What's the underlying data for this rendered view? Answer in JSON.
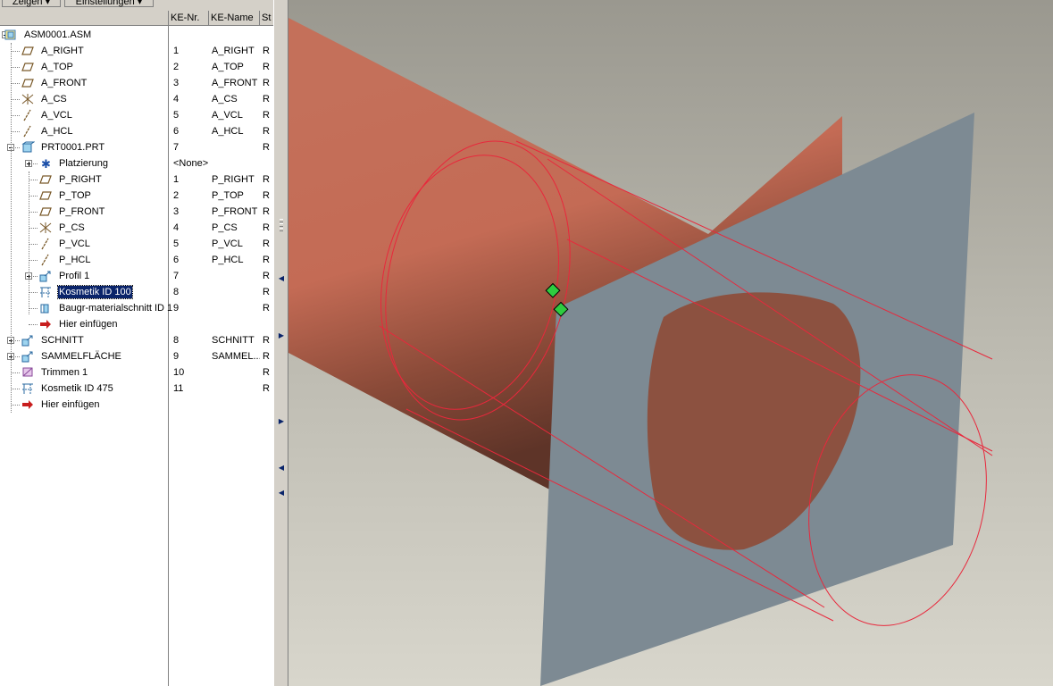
{
  "toolbar": {
    "show_label": "Zeigen ▾",
    "settings_label": "Einstellungen ▾"
  },
  "columns": {
    "tree": "",
    "ke_nr": "KE-Nr.",
    "ke_name": "KE-Name",
    "status": "St"
  },
  "tree": {
    "rows": [
      {
        "label": "ASM0001.ASM",
        "nr": "",
        "name": "",
        "st": "",
        "icon": "assembly-icon"
      },
      {
        "label": "A_RIGHT",
        "nr": "1",
        "name": "A_RIGHT",
        "st": "R",
        "icon": "datum-plane-icon"
      },
      {
        "label": "A_TOP",
        "nr": "2",
        "name": "A_TOP",
        "st": "R",
        "icon": "datum-plane-icon"
      },
      {
        "label": "A_FRONT",
        "nr": "3",
        "name": "A_FRONT",
        "st": "R",
        "icon": "datum-plane-icon"
      },
      {
        "label": "A_CS",
        "nr": "4",
        "name": "A_CS",
        "st": "R",
        "icon": "coordinate-system-icon"
      },
      {
        "label": "A_VCL",
        "nr": "5",
        "name": "A_VCL",
        "st": "R",
        "icon": "datum-axis-icon"
      },
      {
        "label": "A_HCL",
        "nr": "6",
        "name": "A_HCL",
        "st": "R",
        "icon": "datum-axis-icon"
      },
      {
        "label": "PRT0001.PRT",
        "nr": "7",
        "name": "",
        "st": "R",
        "icon": "part-icon"
      },
      {
        "label": "Platzierung",
        "nr": "<None>",
        "name": "",
        "st": "",
        "icon": "placement-icon"
      },
      {
        "label": "P_RIGHT",
        "nr": "1",
        "name": "P_RIGHT",
        "st": "R",
        "icon": "datum-plane-icon"
      },
      {
        "label": "P_TOP",
        "nr": "2",
        "name": "P_TOP",
        "st": "R",
        "icon": "datum-plane-icon"
      },
      {
        "label": "P_FRONT",
        "nr": "3",
        "name": "P_FRONT",
        "st": "R",
        "icon": "datum-plane-icon"
      },
      {
        "label": "P_CS",
        "nr": "4",
        "name": "P_CS",
        "st": "R",
        "icon": "coordinate-system-icon"
      },
      {
        "label": "P_VCL",
        "nr": "5",
        "name": "P_VCL",
        "st": "R",
        "icon": "datum-axis-icon"
      },
      {
        "label": "P_HCL",
        "nr": "6",
        "name": "P_HCL",
        "st": "R",
        "icon": "datum-axis-icon"
      },
      {
        "label": "Profil 1",
        "nr": "7",
        "name": "",
        "st": "R",
        "icon": "profile-icon"
      },
      {
        "label": "Kosmetik ID 100",
        "nr": "8",
        "name": "",
        "st": "R",
        "icon": "cosmetic-icon"
      },
      {
        "label": "Baugr-materialschnitt ID 1",
        "nr": "9",
        "name": "",
        "st": "R",
        "icon": "cut-icon"
      },
      {
        "label": "Hier einfügen",
        "nr": "",
        "name": "",
        "st": "",
        "icon": "insert-here-icon"
      },
      {
        "label": "SCHNITT",
        "nr": "8",
        "name": "SCHNITT",
        "st": "R",
        "icon": "profile-icon"
      },
      {
        "label": "SAMMELFLÄCHE",
        "nr": "9",
        "name": "SAMMEL...",
        "st": "R",
        "icon": "profile-icon"
      },
      {
        "label": "Trimmen 1",
        "nr": "10",
        "name": "",
        "st": "R",
        "icon": "trim-icon"
      },
      {
        "label": "Kosmetik ID 475",
        "nr": "11",
        "name": "",
        "st": "R",
        "icon": "cosmetic-icon"
      },
      {
        "label": "Hier einfügen",
        "nr": "",
        "name": "",
        "st": "",
        "icon": "insert-here-icon"
      }
    ]
  },
  "colors": {
    "selection": "#0a246a",
    "cylinder": "#c46b55",
    "plane": "#7d8a93",
    "edge": "#e8283c",
    "handle": "#2ecc40"
  }
}
